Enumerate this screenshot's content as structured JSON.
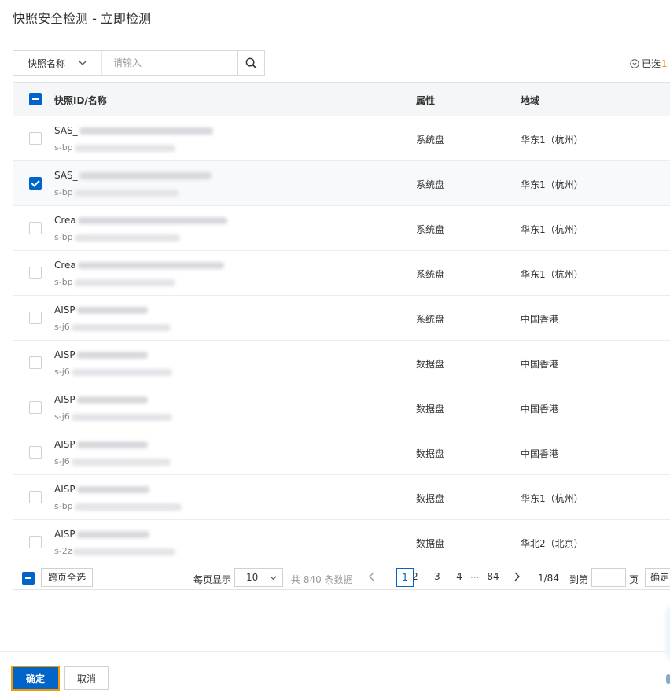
{
  "dialog": {
    "title": "快照安全检测 - 立即检测"
  },
  "search": {
    "field_label": "快照名称",
    "placeholder": "请输入"
  },
  "selected": {
    "label": "已选",
    "count": "1"
  },
  "table": {
    "headers": {
      "name": "快照ID/名称",
      "attribute": "属性",
      "region": "地域"
    },
    "rows": [
      {
        "name_prefix": "SAS_",
        "id_prefix": "s-bp",
        "attribute": "系统盘",
        "region": "华东1（杭州）",
        "checked": false
      },
      {
        "name_prefix": "SAS_",
        "id_prefix": "s-bp",
        "attribute": "系统盘",
        "region": "华东1（杭州）",
        "checked": true
      },
      {
        "name_prefix": "Crea",
        "id_prefix": "s-bp",
        "attribute": "系统盘",
        "region": "华东1（杭州）",
        "checked": false
      },
      {
        "name_prefix": "Crea",
        "id_prefix": "s-bp",
        "attribute": "系统盘",
        "region": "华东1（杭州）",
        "checked": false
      },
      {
        "name_prefix": "AISP",
        "id_prefix": "s-j6",
        "attribute": "系统盘",
        "region": "中国香港",
        "checked": false
      },
      {
        "name_prefix": "AISP",
        "id_prefix": "s-j6",
        "attribute": "数据盘",
        "region": "中国香港",
        "checked": false
      },
      {
        "name_prefix": "AISP",
        "id_prefix": "s-j6",
        "attribute": "数据盘",
        "region": "中国香港",
        "checked": false
      },
      {
        "name_prefix": "AISP",
        "id_prefix": "s-j6",
        "attribute": "数据盘",
        "region": "中国香港",
        "checked": false
      },
      {
        "name_prefix": "AISP",
        "id_prefix": "s-bp",
        "attribute": "数据盘",
        "region": "华东1（杭州）",
        "checked": false
      },
      {
        "name_prefix": "AISP",
        "id_prefix": "s-2z",
        "attribute": "数据盘",
        "region": "华北2（北京）",
        "checked": false
      }
    ]
  },
  "footer": {
    "select_page_label": "跨页全选",
    "per_page_label": "每页显示",
    "page_size": "10",
    "total_text": "共 840 条数据",
    "pages": [
      "1",
      "2",
      "3",
      "4",
      "84"
    ],
    "ellipsis": "···",
    "page_indicator": "1/84",
    "goto_label": "到第",
    "page_unit": "页",
    "goto_button": "确定"
  },
  "actions": {
    "confirm_label": "确定",
    "cancel_label": "取消"
  },
  "colors": {
    "primary": "#0064c8",
    "accent": "#f39800"
  },
  "icons": {
    "search": "search-icon",
    "dropdown": "chevron-down-icon",
    "selected": "circle-chevron-down-icon",
    "prev": "chevron-left-icon",
    "next": "chevron-right-icon"
  }
}
